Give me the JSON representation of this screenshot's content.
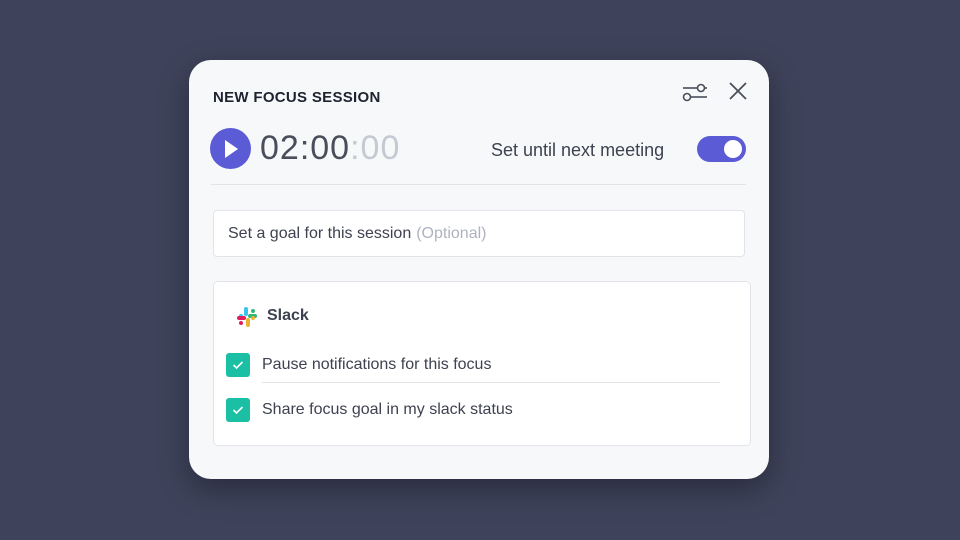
{
  "dialog": {
    "title": "NEW FOCUS SESSION",
    "settings_icon": "sliders-icon",
    "close_icon": "close-icon"
  },
  "timer": {
    "play_icon": "play-icon",
    "main": "02:00",
    "seconds": ":00"
  },
  "meeting_toggle": {
    "label": "Set until next meeting",
    "on": true,
    "color": "#5b5bd6"
  },
  "goal": {
    "placeholder": "Set a goal for this session",
    "optional": "(Optional)"
  },
  "slack": {
    "logo_icon": "slack-logo-icon",
    "name": "Slack",
    "options": [
      {
        "label": "Pause notifications for this focus",
        "checked": true
      },
      {
        "label": "Share focus goal in my slack status",
        "checked": true
      }
    ],
    "check_color": "#1bbfa3"
  },
  "colors": {
    "background": "#3e435b",
    "card": "#f7f8fa",
    "accent": "#5b5bd6"
  }
}
